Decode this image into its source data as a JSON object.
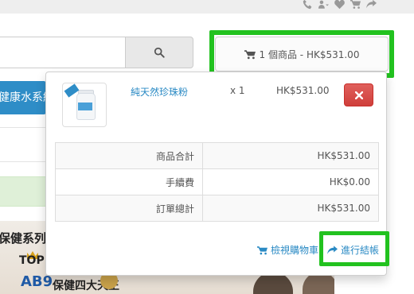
{
  "header": {
    "icons": [
      "phone-icon",
      "user-icon",
      "heart-icon",
      "cart-icon",
      "share-icon"
    ]
  },
  "search": {
    "placeholder": "",
    "button_icon": "search-icon"
  },
  "cart_button": {
    "label": "1 個商品 - HK$531.00",
    "icon": "cart-icon",
    "highlight_color": "#22c21f"
  },
  "background": {
    "menu_label": "健康水系統",
    "banner_line1": "保健系列",
    "banner_badge": "TOP",
    "banner_logo": "AB9",
    "banner_line2": "保健四大天王"
  },
  "cart_dropdown": {
    "item": {
      "name": "純天然珍珠粉",
      "qty": "x 1",
      "price": "HK$531.00",
      "remove_icon": "close-icon"
    },
    "totals": [
      {
        "label": "商品合計",
        "value": "HK$531.00"
      },
      {
        "label": "手續費",
        "value": "HK$0.00"
      },
      {
        "label": "訂單總計",
        "value": "HK$531.00"
      }
    ],
    "view_cart_label": "檢視購物車",
    "checkout_label": "進行結帳",
    "remove_color": "#d9534f",
    "link_color": "#2a8ac4"
  }
}
